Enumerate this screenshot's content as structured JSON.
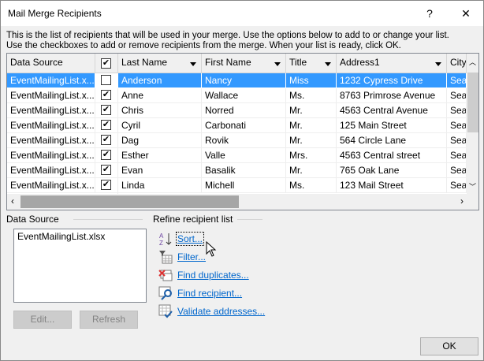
{
  "window": {
    "title": "Mail Merge Recipients",
    "help": "?",
    "close": "✕"
  },
  "description": [
    "This is the list of recipients that will be used in your merge.  Use the options below to add to or change your list.",
    "Use the checkboxes to add or remove recipients from the merge.  When your list is ready, click OK."
  ],
  "table": {
    "columns": [
      "Data Source",
      "",
      "Last Name",
      "First Name",
      "Title",
      "Address1",
      "City"
    ],
    "rows": [
      {
        "source": "EventMailingList.x...",
        "checked": true,
        "last": "Anderson",
        "first": "Nancy",
        "title": "Miss",
        "address": "1232 Cypress Drive",
        "city": "Seat",
        "selected": true
      },
      {
        "source": "EventMailingList.x...",
        "checked": true,
        "last": "Anne",
        "first": "Wallace",
        "title": "Ms.",
        "address": "8763 Primrose Avenue",
        "city": "Seat"
      },
      {
        "source": "EventMailingList.x...",
        "checked": true,
        "last": "Chris",
        "first": "Norred",
        "title": "Mr.",
        "address": "4563 Central Avenue",
        "city": "Seat"
      },
      {
        "source": "EventMailingList.x...",
        "checked": true,
        "last": "Cyril",
        "first": "Carbonati",
        "title": "Mr.",
        "address": "125 Main Street",
        "city": "Seat"
      },
      {
        "source": "EventMailingList.x...",
        "checked": true,
        "last": "Dag",
        "first": "Rovik",
        "title": "Mr.",
        "address": "564 Circle Lane",
        "city": "Seat"
      },
      {
        "source": "EventMailingList.x...",
        "checked": true,
        "last": "Esther",
        "first": "Valle",
        "title": "Mrs.",
        "address": "4563 Central street",
        "city": "Seat"
      },
      {
        "source": "EventMailingList.x...",
        "checked": true,
        "last": "Evan",
        "first": "Basalik",
        "title": "Mr.",
        "address": "765 Oak Lane",
        "city": "Seat"
      },
      {
        "source": "EventMailingList.x...",
        "checked": true,
        "last": "Linda",
        "first": "Michell",
        "title": "Ms.",
        "address": "123 Mail Street",
        "city": "Seat"
      }
    ]
  },
  "data_source": {
    "label": "Data Source",
    "items": [
      "EventMailingList.xlsx"
    ],
    "edit": "Edit...",
    "refresh": "Refresh"
  },
  "refine": {
    "label": "Refine recipient list",
    "links": [
      {
        "label": "Sort...",
        "icon": "sort-az-icon"
      },
      {
        "label": "Filter...",
        "icon": "filter-icon"
      },
      {
        "label": "Find duplicates...",
        "icon": "find-duplicates-icon"
      },
      {
        "label": "Find recipient...",
        "icon": "find-recipient-icon"
      },
      {
        "label": "Validate addresses...",
        "icon": "validate-addresses-icon"
      }
    ]
  },
  "ok": "OK",
  "colors": {
    "selection": "#3399ff",
    "link": "#0066cc"
  }
}
